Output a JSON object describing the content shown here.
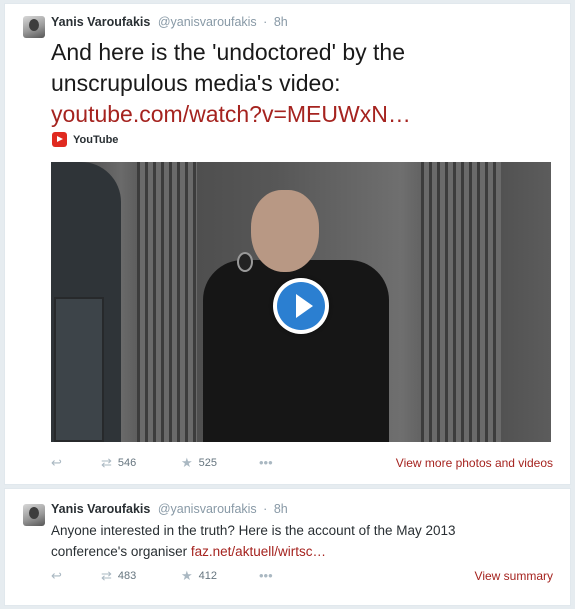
{
  "tweets": [
    {
      "author_name": "Yanis Varoufakis",
      "author_handle": "@yanisvaroufakis",
      "separator": "·",
      "time": "8h",
      "text_line1": "And here is the 'undoctored' by the",
      "text_line2": "unscrupulous media's video:",
      "link": "youtube.com/watch?v=MEUWxN…",
      "card_source": "YouTube",
      "retweets": "546",
      "favorites": "525",
      "more_label": "•••",
      "right_link": "View more photos and videos"
    },
    {
      "author_name": "Yanis Varoufakis",
      "author_handle": "@yanisvaroufakis",
      "separator": "·",
      "time": "8h",
      "text_line1": "Anyone interested in the truth? Here is the account of the May 2013",
      "text_line2_prefix": "conference's organiser ",
      "link": "faz.net/aktuell/wirtsc…",
      "retweets": "483",
      "favorites": "412",
      "more_label": "•••",
      "right_link": "View summary"
    }
  ],
  "icons": {
    "reply": "reply-icon",
    "retweet": "retweet-icon",
    "favorite": "star-icon",
    "more": "more-icon",
    "play": "play-icon",
    "youtube": "youtube-icon"
  },
  "colors": {
    "link": "#a5231f",
    "meta": "#8899a6",
    "play_button": "#2b7fd1",
    "youtube": "#e02a20"
  }
}
